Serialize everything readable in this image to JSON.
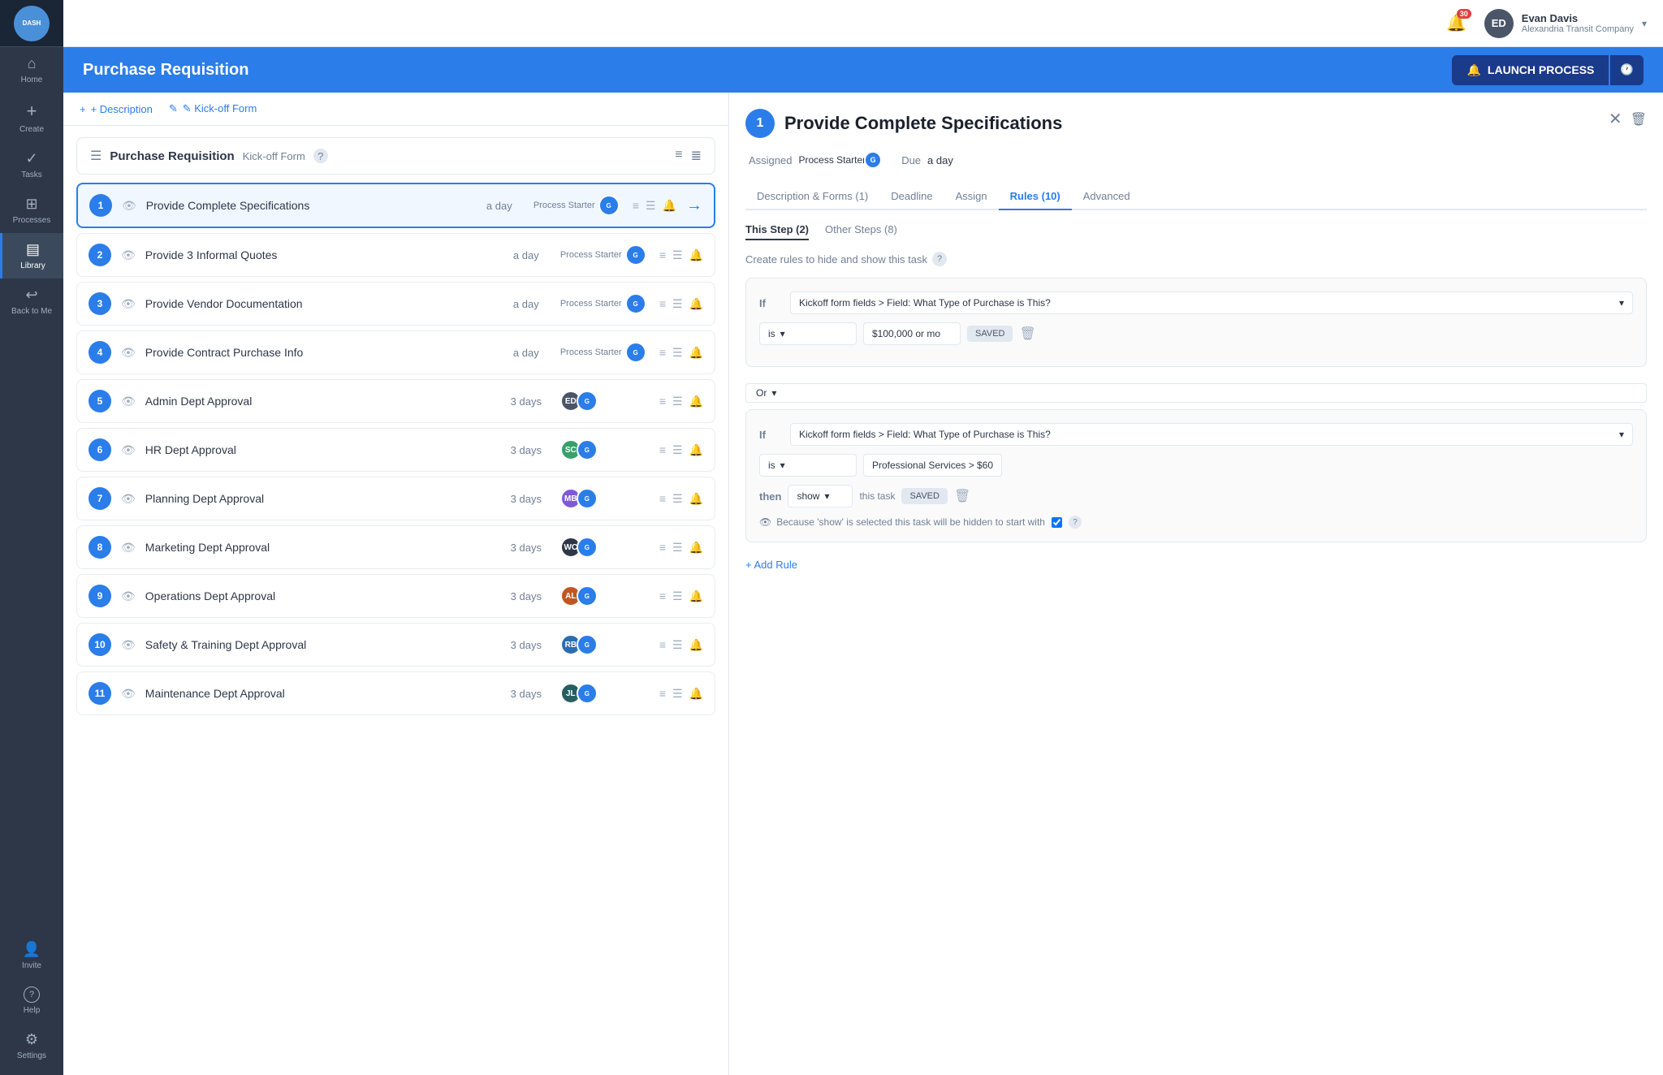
{
  "sidebar": {
    "logo_text": "DASH",
    "items": [
      {
        "id": "home",
        "label": "Home",
        "icon": "⌂"
      },
      {
        "id": "create",
        "label": "Create",
        "icon": "+"
      },
      {
        "id": "tasks",
        "label": "Tasks",
        "icon": "✓"
      },
      {
        "id": "processes",
        "label": "Processes",
        "icon": "⊞"
      },
      {
        "id": "library",
        "label": "Library",
        "icon": "▤",
        "active": true
      },
      {
        "id": "back",
        "label": "Back to Me",
        "icon": "↩"
      },
      {
        "id": "invite",
        "label": "Invite",
        "icon": "👤+"
      },
      {
        "id": "help",
        "label": "Help",
        "icon": "?"
      },
      {
        "id": "settings",
        "label": "Settings",
        "icon": "⚙"
      }
    ]
  },
  "topbar": {
    "notification_count": "30",
    "user_initials": "ED",
    "user_name": "Evan Davis",
    "user_company": "Alexandria Transit Company",
    "chevron": "▾"
  },
  "page_header": {
    "title": "Purchase Requisition",
    "launch_label": "LAUNCH PROCESS",
    "launch_icon": "🔔",
    "clock_icon": "🕐"
  },
  "tabs": [
    {
      "id": "description",
      "label": "+ Description"
    },
    {
      "id": "kickoff",
      "label": "✎ Kick-off Form"
    }
  ],
  "process_list_header": {
    "icon": "☰",
    "name": "Purchase Requisition",
    "kickoff_label": "Kick-off Form",
    "help_icon": "?",
    "menu_icon": "≡",
    "list_icon": "≣"
  },
  "steps": [
    {
      "num": 1,
      "name": "Provide Complete Specifications",
      "duration": "a day",
      "assignee_label": "Process Starter",
      "avatars": [
        {
          "initials": "Guest",
          "color": "#2b7de9"
        }
      ],
      "selected": true
    },
    {
      "num": 2,
      "name": "Provide 3 Informal Quotes",
      "duration": "a day",
      "assignee_label": "Process Starter",
      "avatars": [
        {
          "initials": "Guest",
          "color": "#2b7de9"
        }
      ]
    },
    {
      "num": 3,
      "name": "Provide Vendor Documentation",
      "duration": "a day",
      "assignee_label": "Process Starter",
      "avatars": [
        {
          "initials": "Guest",
          "color": "#2b7de9"
        }
      ]
    },
    {
      "num": 4,
      "name": "Provide Contract Purchase Info",
      "duration": "a day",
      "assignee_label": "Process Starter",
      "avatars": [
        {
          "initials": "Guest",
          "color": "#2b7de9"
        }
      ]
    },
    {
      "num": 5,
      "name": "Admin Dept Approval",
      "duration": "3 days",
      "avatars": [
        {
          "initials": "ED",
          "color": "#4a5568"
        },
        {
          "initials": "Guest",
          "color": "#2b7de9"
        }
      ]
    },
    {
      "num": 6,
      "name": "HR Dept Approval",
      "duration": "3 days",
      "avatars": [
        {
          "initials": "SC",
          "color": "#38a169"
        },
        {
          "initials": "Guest",
          "color": "#2b7de9"
        }
      ]
    },
    {
      "num": 7,
      "name": "Planning Dept Approval",
      "duration": "3 days",
      "avatars": [
        {
          "initials": "MB",
          "color": "#805ad5"
        },
        {
          "initials": "Guest",
          "color": "#2b7de9"
        }
      ]
    },
    {
      "num": 8,
      "name": "Marketing Dept Approval",
      "duration": "3 days",
      "avatars": [
        {
          "initials": "WC",
          "color": "#2d3748"
        },
        {
          "initials": "Guest",
          "color": "#2b7de9"
        }
      ]
    },
    {
      "num": 9,
      "name": "Operations Dept Approval",
      "duration": "3 days",
      "avatars": [
        {
          "initials": "AL",
          "color": "#c05621"
        },
        {
          "initials": "Guest",
          "color": "#2b7de9"
        }
      ]
    },
    {
      "num": 10,
      "name": "Safety & Training Dept Approval",
      "duration": "3 days",
      "avatars": [
        {
          "initials": "RB",
          "color": "#2b6cb0"
        },
        {
          "initials": "Guest",
          "color": "#2b7de9"
        }
      ]
    },
    {
      "num": 11,
      "name": "Maintenance Dept Approval",
      "duration": "3 days",
      "avatars": [
        {
          "initials": "JL",
          "color": "#285e61"
        },
        {
          "initials": "Guest",
          "color": "#2b7de9"
        }
      ]
    }
  ],
  "detail": {
    "step_num": "1",
    "title": "Provide Complete Specifications",
    "assigned_label": "Assigned",
    "process_starter_label": "Process Starter",
    "guest_label": "Guest",
    "due_label": "Due",
    "due_value": "a day",
    "tabs": [
      {
        "id": "description",
        "label": "Description & Forms (1)"
      },
      {
        "id": "deadline",
        "label": "Deadline"
      },
      {
        "id": "assign",
        "label": "Assign"
      },
      {
        "id": "rules",
        "label": "Rules (10)",
        "active": true
      },
      {
        "id": "advanced",
        "label": "Advanced"
      }
    ],
    "rules": {
      "subtabs": [
        {
          "id": "this_step",
          "label": "This Step (2)",
          "active": true
        },
        {
          "id": "other_steps",
          "label": "Other Steps (8)"
        }
      ],
      "description": "Create rules to hide and show this task",
      "rule1": {
        "if_label": "If",
        "condition_field": "Kickoff form fields > Field: What Type of Purchase is This?",
        "condition_op": "is",
        "condition_value": "$100,000 or mo",
        "saved_label": "SAVED"
      },
      "or_label": "Or",
      "rule2": {
        "if_label": "If",
        "condition_field": "Kickoff form fields > Field: What Type of Purchase is This?",
        "condition_op": "is",
        "condition_value": "Professional Services > $60",
        "then_label": "then",
        "then_value": "show",
        "then_task": "this task",
        "saved_label": "SAVED"
      },
      "footer_note": "Because 'show' is selected this task will be hidden to start with",
      "add_rule_label": "+ Add Rule"
    }
  }
}
